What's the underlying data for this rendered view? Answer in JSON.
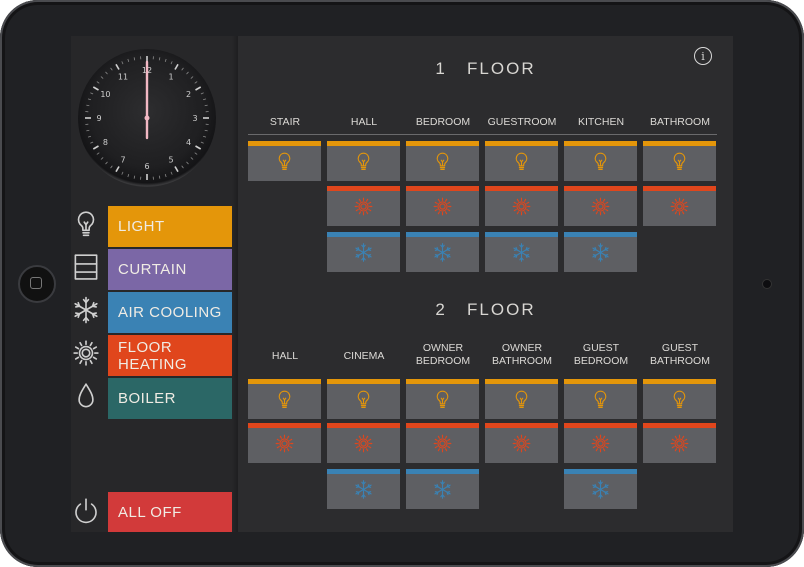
{
  "colors": {
    "light": "#e4960a",
    "curtain": "#7b67a6",
    "air_cooling": "#3a82b4",
    "floor_heating": "#e0461c",
    "boiler": "#2b6766",
    "all_off": "#d23a3a",
    "tile": "#5e5f63"
  },
  "clock": {
    "numbers": [
      "12",
      "1",
      "2",
      "3",
      "4",
      "5",
      "6",
      "7",
      "8",
      "9",
      "10",
      "11"
    ]
  },
  "sidebar": {
    "items": [
      {
        "key": "light",
        "label": "LIGHT",
        "icon": "bulb-icon"
      },
      {
        "key": "curtain",
        "label": "CURTAIN",
        "icon": "curtain-icon"
      },
      {
        "key": "air_cooling",
        "label": "AIR COOLING",
        "icon": "snowflake-icon"
      },
      {
        "key": "floor_heating",
        "label": "FLOOR HEATING",
        "icon": "heater-icon"
      },
      {
        "key": "boiler",
        "label": "BOILER",
        "icon": "water-drop-icon"
      }
    ],
    "all_off": {
      "label": "ALL OFF",
      "icon": "power-icon"
    }
  },
  "info_icon": "i",
  "floors": [
    {
      "title": "1   FLOOR",
      "rooms": [
        {
          "name": "STAIR",
          "light": true,
          "heating": false,
          "cooling": false
        },
        {
          "name": "HALL",
          "light": true,
          "heating": true,
          "cooling": true
        },
        {
          "name": "BEDROOM",
          "light": true,
          "heating": true,
          "cooling": true
        },
        {
          "name": "GUESTROOM",
          "light": true,
          "heating": true,
          "cooling": true
        },
        {
          "name": "KITCHEN",
          "light": true,
          "heating": true,
          "cooling": true
        },
        {
          "name": "BATHROOM",
          "light": true,
          "heating": true,
          "cooling": false
        }
      ]
    },
    {
      "title": "2   FLOOR",
      "rooms": [
        {
          "name": "HALL",
          "light": true,
          "heating": true,
          "cooling": false
        },
        {
          "name": "CINEMA",
          "light": true,
          "heating": true,
          "cooling": true
        },
        {
          "name": "OWNER\nBEDROOM",
          "light": true,
          "heating": true,
          "cooling": true
        },
        {
          "name": "OWNER\nBATHROOM",
          "light": true,
          "heating": true,
          "cooling": false
        },
        {
          "name": "GUEST\nBEDROOM",
          "light": true,
          "heating": true,
          "cooling": true
        },
        {
          "name": "GUEST\nBATHROOM",
          "light": true,
          "heating": true,
          "cooling": false
        }
      ]
    }
  ]
}
